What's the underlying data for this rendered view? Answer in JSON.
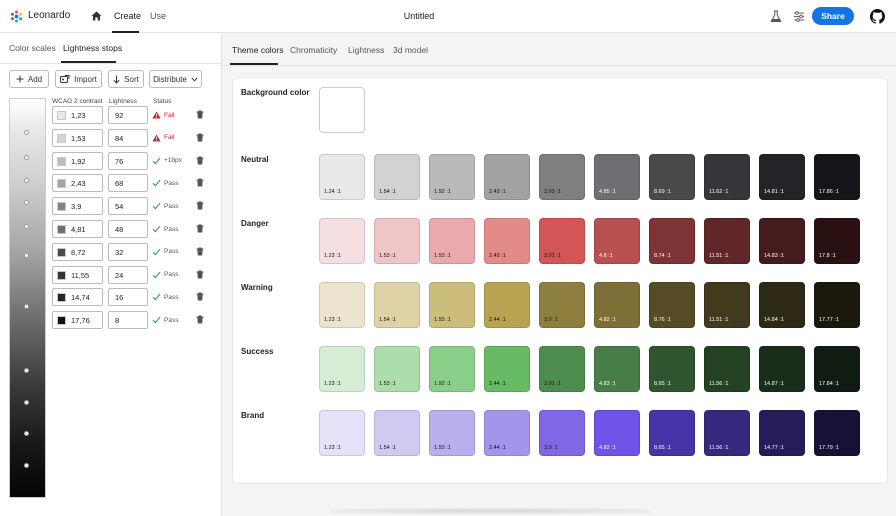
{
  "header": {
    "app_name": "Leonardo",
    "nav": [
      "Create",
      "Use"
    ],
    "doc_title": "Untitled",
    "share_label": "Share"
  },
  "left_panel": {
    "tabs": [
      "Color scales",
      "Lightness stops"
    ],
    "active_tab": "Lightness stops",
    "toolbar": {
      "add": "Add",
      "import": "Import",
      "sort": "Sort",
      "distribute": "Distribute"
    },
    "columns": {
      "contrast": "WCAG 2 contrast",
      "lightness": "Lightness",
      "status": "Status"
    },
    "rows": [
      {
        "swatch": "#e9e9e9",
        "contrast": "1,23",
        "lightness": "92",
        "status": "Fail",
        "status_type": "fail"
      },
      {
        "swatch": "#d4d4d4",
        "contrast": "1,53",
        "lightness": "84",
        "status": "Fail",
        "status_type": "fail"
      },
      {
        "swatch": "#bcbcbc",
        "contrast": "1,92",
        "lightness": "76",
        "status": "+18px",
        "status_type": "pass"
      },
      {
        "swatch": "#a5a5a5",
        "contrast": "2,43",
        "lightness": "68",
        "status": "Pass",
        "status_type": "pass"
      },
      {
        "swatch": "#838383",
        "contrast": "3,9",
        "lightness": "54",
        "status": "Pass",
        "status_type": "pass"
      },
      {
        "swatch": "#707070",
        "contrast": "4,81",
        "lightness": "48",
        "status": "Pass",
        "status_type": "pass"
      },
      {
        "swatch": "#4a4a4a",
        "contrast": "8,72",
        "lightness": "32",
        "status": "Pass",
        "status_type": "pass"
      },
      {
        "swatch": "#363636",
        "contrast": "11,55",
        "lightness": "24",
        "status": "Pass",
        "status_type": "pass"
      },
      {
        "swatch": "#242424",
        "contrast": "14,74",
        "lightness": "16",
        "status": "Pass",
        "status_type": "pass"
      },
      {
        "swatch": "#141414",
        "contrast": "17,76",
        "lightness": "8",
        "status": "Pass",
        "status_type": "pass"
      }
    ]
  },
  "right_panel": {
    "tabs": [
      "Theme colors",
      "Chromaticity",
      "Lightness",
      "3d model"
    ],
    "active_tab": "Theme colors",
    "background_label": "Background color",
    "background_color": "#ffffff",
    "scales": [
      {
        "name": "Neutral",
        "colors": [
          "#e8e8e9",
          "#d2d2d3",
          "#b9b9ba",
          "#a2a2a4",
          "#7f7f82",
          "#6f6f73",
          "#49494c",
          "#36363a",
          "#242428",
          "#151519"
        ],
        "ratios": [
          "1.24 :1",
          "1.54 :1",
          "1.92 :1",
          "2.43 :1",
          "3.93 :1",
          "4.85 :1",
          "8.69 :1",
          "11.62 :1",
          "14.81 :1",
          "17.86 :1"
        ]
      },
      {
        "name": "Danger",
        "colors": [
          "#f6dfe0",
          "#f0c5c6",
          "#eaa9aa",
          "#e38a8b",
          "#d45556",
          "#b85052",
          "#7e3335",
          "#612628",
          "#461b1c",
          "#2a1011"
        ],
        "ratios": [
          "1.23 :1",
          "1.53 :1",
          "1.93 :1",
          "2.43 :1",
          "3.91 :1",
          "4.8 :1",
          "8.74 :1",
          "11.51 :1",
          "14.83 :1",
          "17.8 :1"
        ]
      },
      {
        "name": "Warning",
        "colors": [
          "#ede4d0",
          "#dfd2a6",
          "#ccbd7a",
          "#b9a352",
          "#8f7f3e",
          "#7e6f37",
          "#554b25",
          "#413a1d",
          "#2e2915",
          "#1b190e"
        ],
        "ratios": [
          "1.23 :1",
          "1.54 :1",
          "1.93 :1",
          "2.44 :1",
          "3.9 :1",
          "4.82 :1",
          "8.76 :1",
          "11.51 :1",
          "14.84 :1",
          "17.77 :1"
        ]
      },
      {
        "name": "Success",
        "colors": [
          "#d5ecd5",
          "#addcad",
          "#8acf89",
          "#66bb64",
          "#4e8d4d",
          "#477d46",
          "#2f552e",
          "#234222",
          "#192e18",
          "#101c10"
        ],
        "ratios": [
          "1.23 :1",
          "1.53 :1",
          "1.92 :1",
          "2.44 :1",
          "3.91 :1",
          "4.83 :1",
          "8.65 :1",
          "11.56 :1",
          "14.87 :1",
          "17.84 :1"
        ]
      },
      {
        "name": "Brand",
        "colors": [
          "#e6e1f8",
          "#d2c9f3",
          "#bbaeee",
          "#a494ea",
          "#7f67e5",
          "#6f52e8",
          "#4533a8",
          "#35287d",
          "#261c59",
          "#181136"
        ],
        "ratios": [
          "1.23 :1",
          "1.54 :1",
          "1.93 :1",
          "2.44 :1",
          "3.9 :1",
          "4.82 :1",
          "8.65 :1",
          "11.56 :1",
          "14.77 :1",
          "17.79 :1"
        ]
      }
    ]
  }
}
